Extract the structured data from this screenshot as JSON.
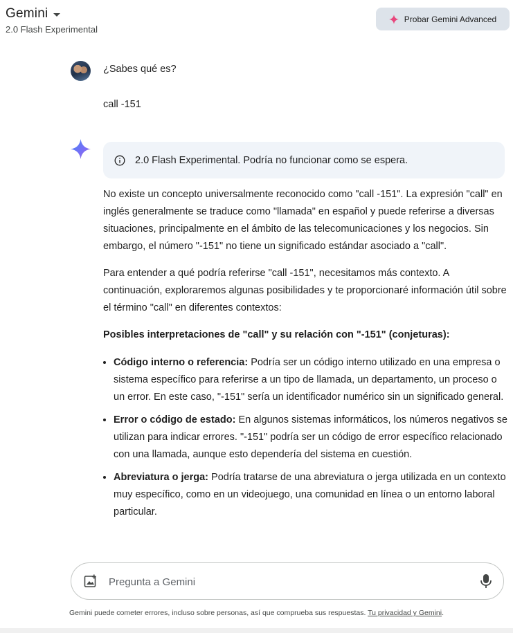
{
  "header": {
    "app_title": "Gemini",
    "model_name": "2.0 Flash Experimental",
    "advanced_button_label": "Probar Gemini Advanced"
  },
  "conversation": {
    "user_question": "¿Sabes qué es?",
    "user_detail": "call -151",
    "notice": "2.0 Flash Experimental. Podría no funcionar como se espera.",
    "paragraphs": [
      "No existe un concepto universalmente reconocido como \"call -151\". La expresión \"call\" en inglés generalmente se traduce como \"llamada\" en español y puede referirse a diversas situaciones, principalmente en el ámbito de las telecomunicaciones y los negocios. Sin embargo, el número \"-151\" no tiene un significado estándar asociado a \"call\".",
      "Para entender a qué podría referirse \"call -151\", necesitamos más contexto. A continuación, exploraremos algunas posibilidades y te proporcionaré información útil sobre el término \"call\" en diferentes contextos:"
    ],
    "section_heading": "Posibles interpretaciones de \"call\" y su relación con \"-151\" (conjeturas):",
    "bullets": [
      {
        "term": "Código interno o referencia:",
        "text": " Podría ser un código interno utilizado en una empresa o sistema específico para referirse a un tipo de llamada, un departamento, un proceso o un error. En este caso, \"-151\" sería un identificador numérico sin un significado general."
      },
      {
        "term": "Error o código de estado:",
        "text": " En algunos sistemas informáticos, los números negativos se utilizan para indicar errores. \"-151\" podría ser un código de error específico relacionado con una llamada, aunque esto dependería del sistema en cuestión."
      },
      {
        "term": "Abreviatura o jerga:",
        "text": " Podría tratarse de una abreviatura o jerga utilizada en un contexto muy específico, como en un videojuego, una comunidad en línea o un entorno laboral particular."
      }
    ]
  },
  "input": {
    "placeholder": "Pregunta a Gemini"
  },
  "footer": {
    "disclaimer": "Gemini puede cometer errores, incluso sobre personas, así que comprueba sus respuestas.",
    "privacy_link": "Tu privacidad y Gemini",
    "period": "."
  },
  "colors": {
    "advanced_button_bg": "#dde3ea",
    "notice_bg": "#f0f4f9",
    "spark_pink": "#e8467c",
    "spark_blue": "#4285f4"
  },
  "icons": {
    "caret": "caret-down-icon",
    "spark": "gemini-spark-icon",
    "info": "info-icon",
    "image_upload": "image-upload-icon",
    "mic": "microphone-icon"
  }
}
